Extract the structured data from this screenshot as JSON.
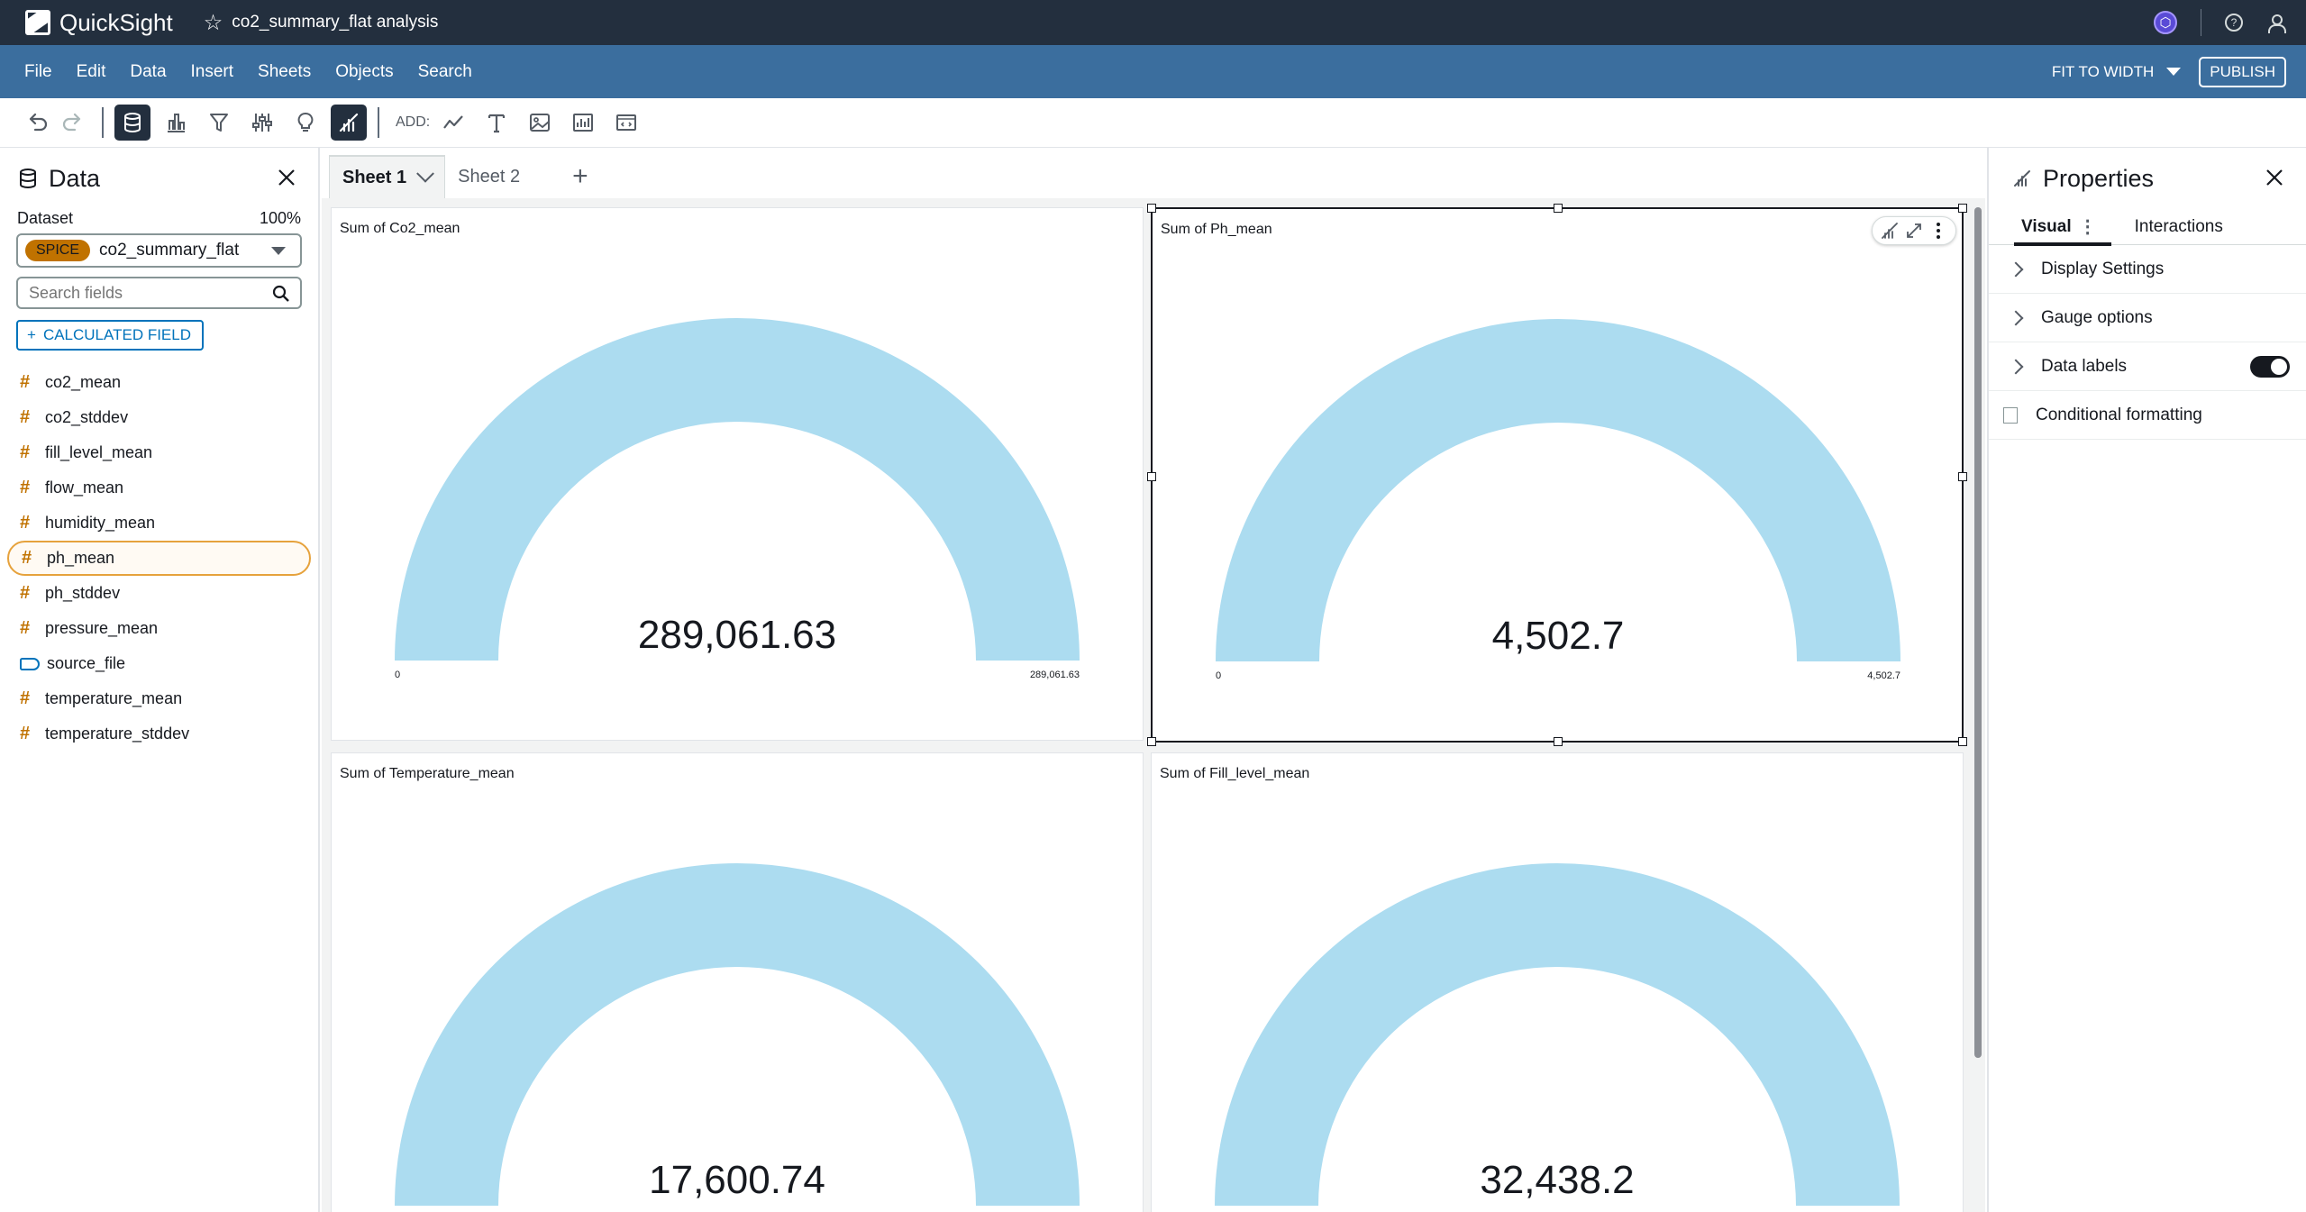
{
  "topbar": {
    "app_name": "QuickSight",
    "analysis_title": "co2_summary_flat analysis",
    "icons": [
      "quicksight-logo-icon",
      "star-icon",
      "assistant-icon",
      "help-icon",
      "user-icon"
    ]
  },
  "menubar": {
    "items": [
      "File",
      "Edit",
      "Data",
      "Insert",
      "Sheets",
      "Objects",
      "Search"
    ],
    "fit_label": "FIT TO WIDTH",
    "publish_label": "PUBLISH"
  },
  "toolbar": {
    "add_label": "ADD:",
    "icons": [
      "undo-icon",
      "redo-icon",
      "data-icon",
      "visualize-icon",
      "filter-icon",
      "parameters-icon",
      "insights-icon",
      "properties-icon",
      "line-chart-icon",
      "text-icon",
      "image-icon",
      "insight-visual-icon",
      "embed-icon"
    ]
  },
  "data_panel": {
    "title": "Data",
    "dataset_label": "Dataset",
    "dataset_percent": "100%",
    "spice_badge": "SPICE",
    "dataset_name": "co2_summary_flat",
    "search_placeholder": "Search fields",
    "calc_field_label": "CALCULATED FIELD",
    "fields": [
      {
        "name": "co2_mean",
        "type": "measure"
      },
      {
        "name": "co2_stddev",
        "type": "measure"
      },
      {
        "name": "fill_level_mean",
        "type": "measure"
      },
      {
        "name": "flow_mean",
        "type": "measure"
      },
      {
        "name": "humidity_mean",
        "type": "measure"
      },
      {
        "name": "ph_mean",
        "type": "measure",
        "selected": true
      },
      {
        "name": "ph_stddev",
        "type": "measure"
      },
      {
        "name": "pressure_mean",
        "type": "measure"
      },
      {
        "name": "source_file",
        "type": "dimension"
      },
      {
        "name": "temperature_mean",
        "type": "measure"
      },
      {
        "name": "temperature_stddev",
        "type": "measure"
      }
    ]
  },
  "sheets": {
    "tabs": [
      "Sheet 1",
      "Sheet 2"
    ],
    "active": 0,
    "add_label": "+"
  },
  "visuals": [
    {
      "title": "Sum of Co2_mean",
      "value": "289,061.63",
      "min_label": "0",
      "max_label": "289,061.63",
      "fill_fraction": 1.0
    },
    {
      "title": "Sum of Ph_mean",
      "value": "4,502.7",
      "min_label": "0",
      "max_label": "4,502.7",
      "fill_fraction": 1.0,
      "selected": true
    },
    {
      "title": "Sum of Temperature_mean",
      "value": "17,600.74",
      "min_label": "",
      "max_label": "",
      "fill_fraction": 1.0
    },
    {
      "title": "Sum of Fill_level_mean",
      "value": "32,438.2",
      "min_label": "",
      "max_label": "",
      "fill_fraction": 1.0
    }
  ],
  "gauge_color": "#acdcf0",
  "properties": {
    "title": "Properties",
    "tabs": [
      "Visual",
      "Interactions"
    ],
    "rows": [
      "Display Settings",
      "Gauge options",
      "Data labels"
    ],
    "conditional_formatting": "Conditional formatting",
    "data_labels_on": true
  }
}
